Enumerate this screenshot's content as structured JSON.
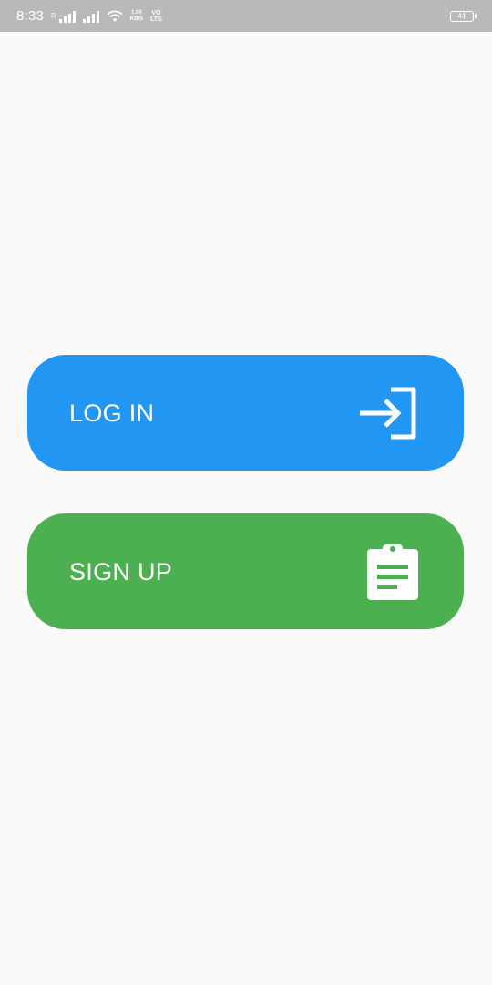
{
  "status_bar": {
    "time": "8:33",
    "roaming_indicator": "R",
    "speed_value": "1.00",
    "speed_unit": "KB/S",
    "volte_line1": "VO",
    "volte_line2": "LTE",
    "battery_level": "41",
    "icons": [
      "signal-icon",
      "signal-icon",
      "wifi-icon",
      "battery-icon"
    ]
  },
  "buttons": {
    "login": {
      "label": "LOG IN",
      "icon": "login-icon",
      "color": "#2196f3"
    },
    "signup": {
      "label": "SIGN UP",
      "icon": "clipboard-icon",
      "color": "#4caf50"
    }
  },
  "colors": {
    "background": "#fafafa",
    "status_bar": "#b9b9b9",
    "text_on_button": "#ffffff"
  }
}
